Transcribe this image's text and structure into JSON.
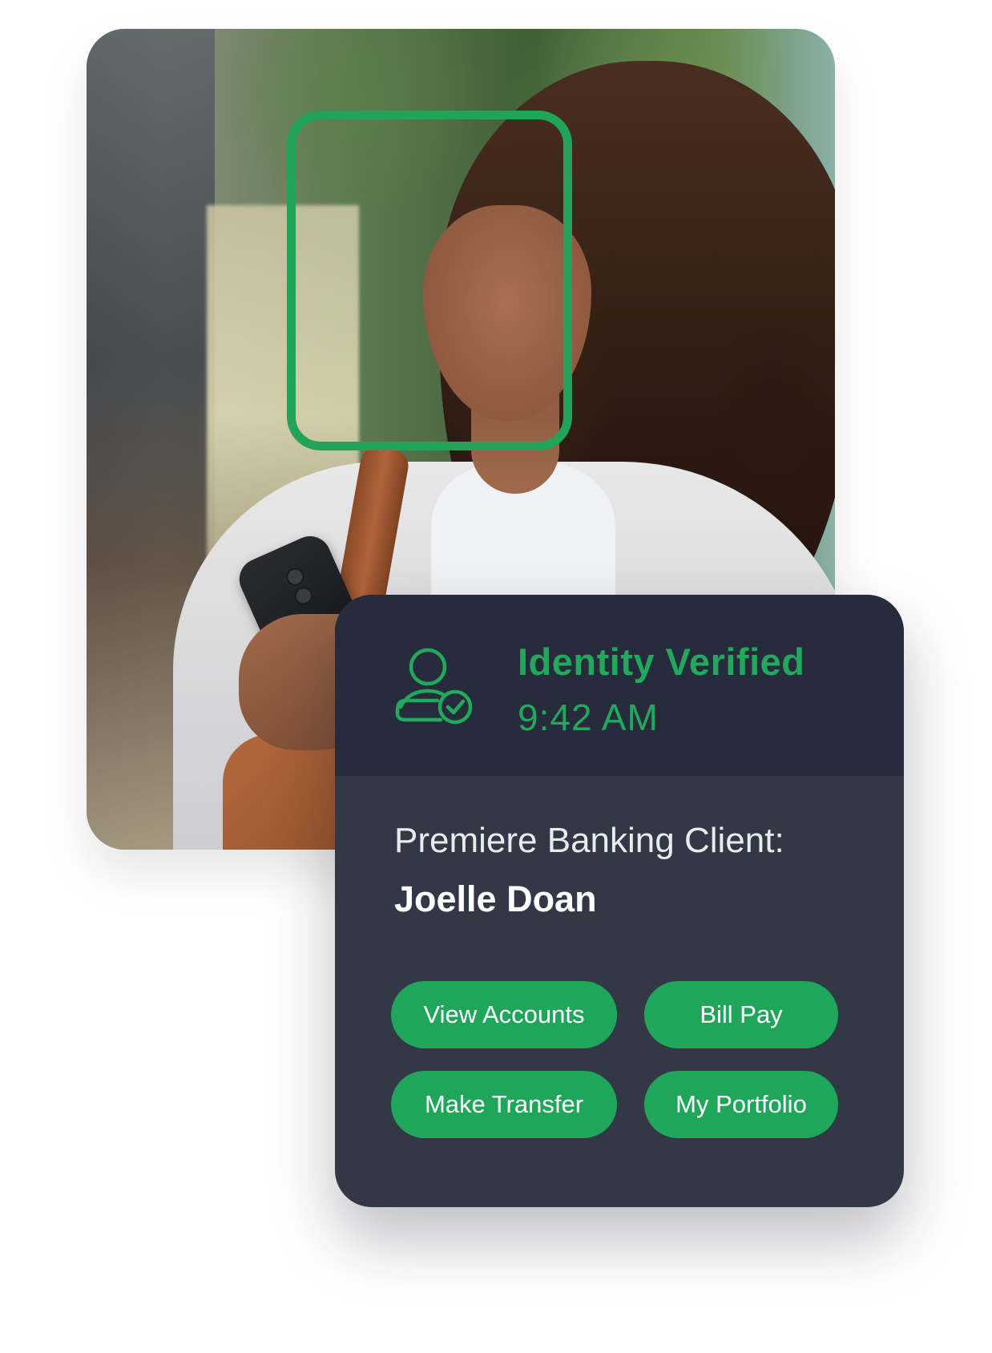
{
  "identity": {
    "status": "Identity Verified",
    "time": "9:42 AM",
    "icon": "user-check-icon"
  },
  "client": {
    "label": "Premiere Banking Client:",
    "name": "Joelle Doan"
  },
  "actions": {
    "view_accounts": "View Accounts",
    "bill_pay": "Bill Pay",
    "make_transfer": "Make Transfer",
    "my_portfolio": "My Portfolio"
  },
  "colors": {
    "accent_green": "#22a85c",
    "card_dark": "#262c3b",
    "card_body": "#323846",
    "button_green": "#1fa65b"
  }
}
